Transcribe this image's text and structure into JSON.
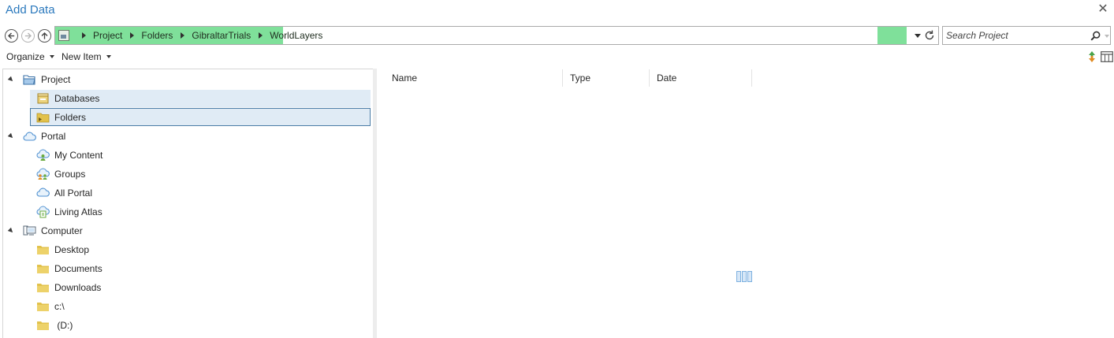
{
  "window": {
    "title": "Add Data",
    "close_glyph": "✕"
  },
  "navigation": {
    "breadcrumbs": [
      "Project",
      "Folders",
      "GibraltarTrials",
      "WorldLayers"
    ],
    "search_placeholder": "Search Project",
    "highlight_color": "#7fe09a"
  },
  "toolbar": {
    "organize_label": "Organize",
    "new_item_label": "New Item"
  },
  "tree": {
    "project": {
      "label": "Project",
      "children": [
        {
          "label": "Databases",
          "state": "hover"
        },
        {
          "label": "Folders",
          "state": "selected"
        }
      ]
    },
    "portal": {
      "label": "Portal",
      "children": [
        {
          "label": "My Content"
        },
        {
          "label": "Groups"
        },
        {
          "label": "All Portal"
        },
        {
          "label": "Living Atlas"
        }
      ]
    },
    "computer": {
      "label": "Computer",
      "children": [
        {
          "label": "Desktop"
        },
        {
          "label": "Documents"
        },
        {
          "label": "Downloads"
        },
        {
          "label": "c:\\"
        },
        {
          "label": " (D:)"
        }
      ]
    }
  },
  "content": {
    "columns": [
      "Name",
      "Type",
      "Date"
    ],
    "status": "loading"
  },
  "colors": {
    "title": "#2b79bd",
    "selection_background": "#e0ebf5",
    "selection_border": "#4a7ca6",
    "folder": "#e2c24c"
  }
}
